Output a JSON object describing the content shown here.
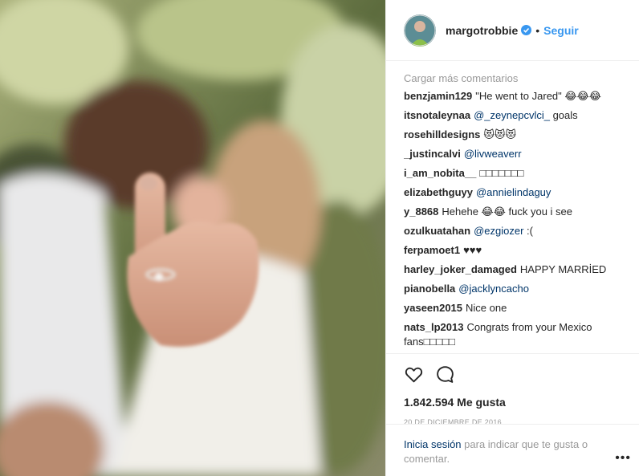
{
  "post": {
    "username": "margotrobbie",
    "separator": "•",
    "follow_label": "Seguir"
  },
  "comments": {
    "load_more": "Cargar más comentarios",
    "items": [
      {
        "author": "benzjamin129",
        "text": "\"He went to Jared\" 😂😂😂",
        "mention": ""
      },
      {
        "author": "itsnotaleynaa",
        "mention": "@_zeynepcvlci_",
        "text": "goals"
      },
      {
        "author": "rosehilldesigns",
        "text": "😻😻😻",
        "mention": ""
      },
      {
        "author": "_justincalvi",
        "mention": "@livweaverr",
        "text": ""
      },
      {
        "author": "i_am_nobita__",
        "text": "□□□□□□□",
        "mention": ""
      },
      {
        "author": "elizabethguyy",
        "mention": "@annielindaguy",
        "text": ""
      },
      {
        "author": "y_8868",
        "text": "Hehehe 😂😂 fuck you i see",
        "mention": ""
      },
      {
        "author": "ozulkuatahan",
        "mention": "@ezgiozer",
        "text": ":("
      },
      {
        "author": "ferpamoet1",
        "text": "♥♥♥",
        "mention": ""
      },
      {
        "author": "harley_joker_damaged",
        "text": "HAPPY MARRİED",
        "mention": ""
      },
      {
        "author": "pianobella",
        "mention": "@jacklyncacho",
        "text": ""
      },
      {
        "author": "yaseen2015",
        "text": "Nice one",
        "mention": ""
      },
      {
        "author": "nats_lp2013",
        "text": "Congrats from your Mexico fans□□□□□",
        "mention": ""
      }
    ]
  },
  "stats": {
    "likes": "1.842.594 Me gusta",
    "date": "20 DE DICIEMBRE DE 2016"
  },
  "login": {
    "link": "Inicia sesión",
    "text": " para indicar que te gusta o comentar."
  },
  "more_label": "•••",
  "icons": {
    "like": "heart-icon",
    "comment": "comment-icon",
    "verified": "verified-badge-icon"
  },
  "colors": {
    "accent": "#3897f0",
    "link": "#003569",
    "muted": "#999999",
    "text": "#262626"
  }
}
